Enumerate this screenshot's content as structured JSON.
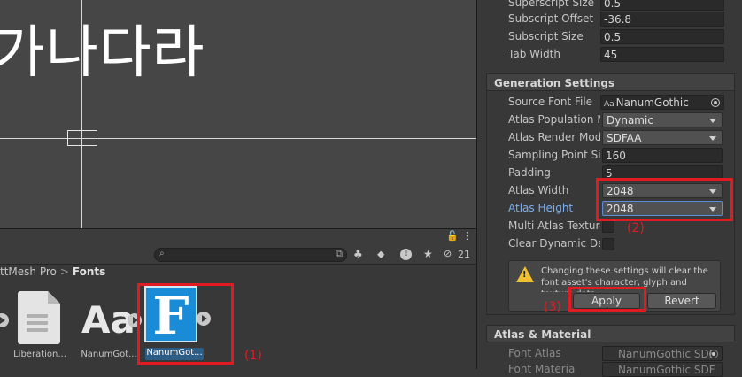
{
  "scene": {
    "sample_text": "가나다라"
  },
  "project": {
    "topbar_lock_icon": "lock-icon",
    "search": {
      "placeholder": ""
    },
    "toolbar_count": "21",
    "breadcrumb": {
      "parent": "ttMesh Pro",
      "separator": ">",
      "current": "Fonts"
    },
    "assets": [
      {
        "label": "Liberation...",
        "icon": "document-icon"
      },
      {
        "label": "NanumGot...",
        "icon": "font-icon"
      },
      {
        "label": "NanumGot...",
        "icon": "font-asset-icon",
        "selected": true
      }
    ]
  },
  "inspector": {
    "top_props": [
      {
        "label": "Superscript Size",
        "value": "0.5"
      },
      {
        "label": "Subscript Offset",
        "value": "-36.8"
      },
      {
        "label": "Subscript Size",
        "value": "0.5"
      },
      {
        "label": "Tab Width",
        "value": "45"
      }
    ],
    "generation_header": "Generation Settings",
    "generation_props": {
      "source_font_label": "Source Font File",
      "source_font_value": "NanumGothic",
      "source_font_glyph": "Aa",
      "atlas_population_label": "Atlas Population M",
      "atlas_population_value": "Dynamic",
      "atlas_render_label": "Atlas Render Mode",
      "atlas_render_value": "SDFAA",
      "sampling_label": "Sampling Point Siz",
      "sampling_value": "160",
      "padding_label": "Padding",
      "padding_value": "5",
      "atlas_width_label": "Atlas Width",
      "atlas_width_value": "2048",
      "atlas_height_label": "Atlas Height",
      "atlas_height_value": "2048",
      "multi_atlas_label": "Multi Atlas Texture",
      "clear_dynamic_label": "Clear Dynamic Dat"
    },
    "warning": {
      "text": "Changing these settings will clear the font asset's character, glyph and texture data."
    },
    "apply_label": "Apply",
    "revert_label": "Revert",
    "atlas_material_header": "Atlas & Material",
    "font_atlas_label": "Font Atlas",
    "font_atlas_value": "NanumGothic SDF",
    "font_material_label": "Font Materia",
    "font_material_value": "NanumGothic SDF"
  },
  "annotations": {
    "label_1": "(1)",
    "label_2": "(2)",
    "label_3": "(3)",
    "color": "#e11b22"
  }
}
